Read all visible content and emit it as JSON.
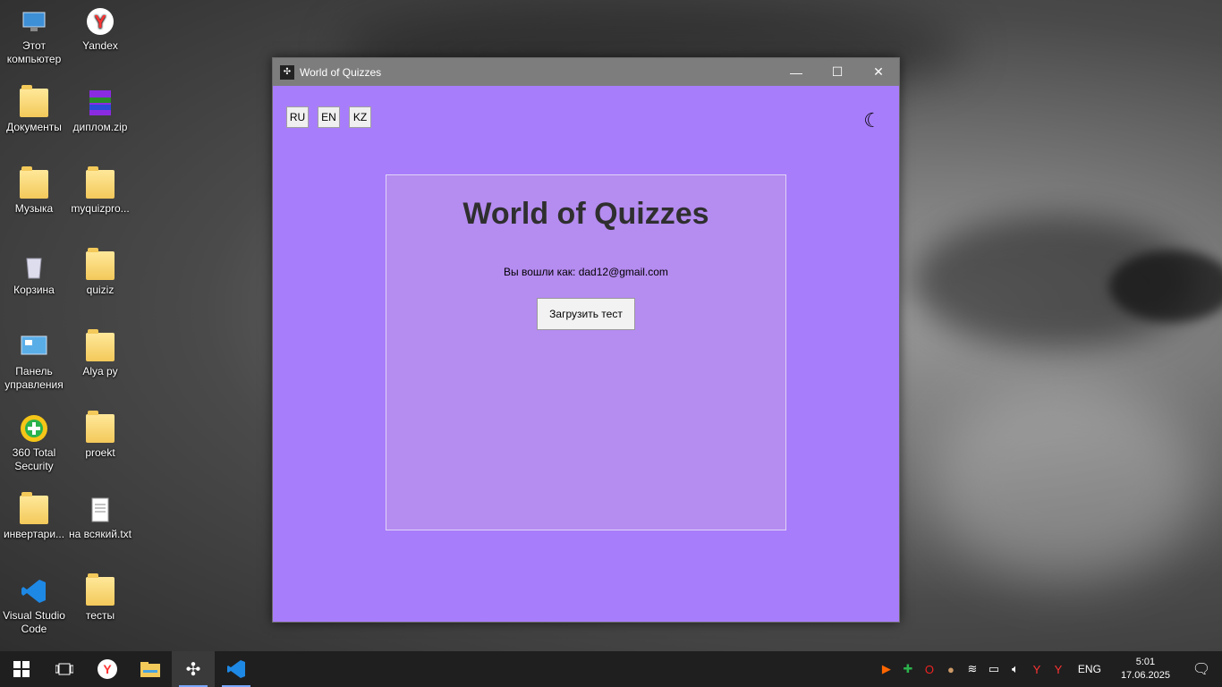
{
  "desktop": {
    "icons": [
      {
        "label": "Этот компьютер",
        "icon": "computer-icon"
      },
      {
        "label": "Yandex",
        "icon": "yandex-browser-icon"
      },
      {
        "label": "Документы",
        "icon": "documents-icon"
      },
      {
        "label": "диплом.zip",
        "icon": "winrar-archive-icon"
      },
      {
        "label": "Музыка",
        "icon": "music-folder-icon"
      },
      {
        "label": "myquizpro...",
        "icon": "folder-icon"
      },
      {
        "label": "Корзина",
        "icon": "recycle-bin-icon"
      },
      {
        "label": "quiziz",
        "icon": "folder-icon"
      },
      {
        "label": "Панель управления",
        "icon": "control-panel-icon"
      },
      {
        "label": "Alya py",
        "icon": "folder-icon"
      },
      {
        "label": "360 Total Security",
        "icon": "360-security-icon"
      },
      {
        "label": "proekt",
        "icon": "folder-icon"
      },
      {
        "label": "инвертари...",
        "icon": "file-icon"
      },
      {
        "label": "на всякий.txt",
        "icon": "text-file-icon"
      },
      {
        "label": "Visual Studio Code",
        "icon": "vscode-icon"
      },
      {
        "label": "тесты",
        "icon": "folder-icon"
      }
    ]
  },
  "window": {
    "title": "World of Quizzes",
    "controls": {
      "minimize": "—",
      "maximize": "☐",
      "close": "✕"
    },
    "languages": [
      "RU",
      "EN",
      "KZ"
    ],
    "theme_toggle": "☾",
    "card": {
      "heading": "World of Quizzes",
      "login_text": "Вы вошли как: dad12@gmail.com",
      "load_button": "Загрузить тест"
    }
  },
  "taskbar": {
    "language": "ENG",
    "time": "5:01",
    "date": "17.06.2025"
  },
  "colors": {
    "window_bg": "#a87dfb",
    "card_bg": "#b58cf0",
    "titlebar": "#7d7d7d",
    "taskbar": "#1f1f1f"
  }
}
